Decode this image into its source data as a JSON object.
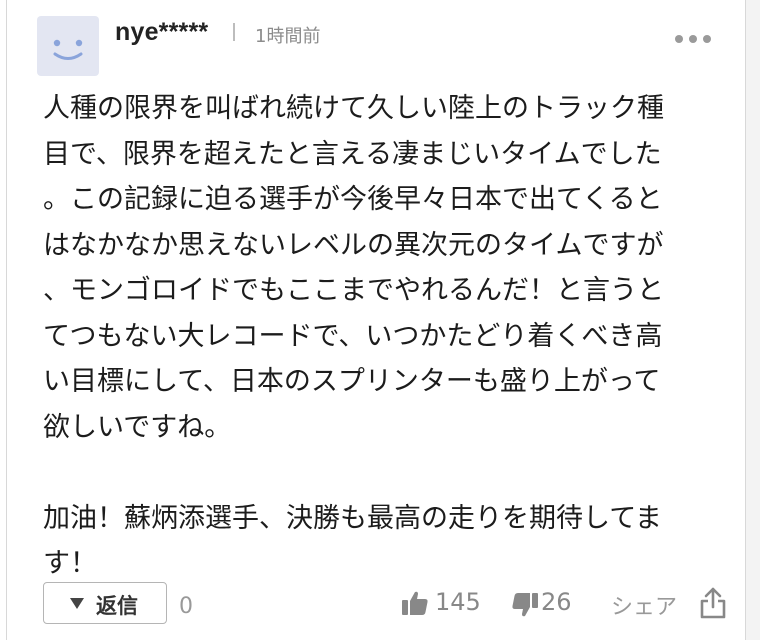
{
  "comment": {
    "user": "nye*****",
    "time": "1時間前",
    "avatar_icon": "smiley-face-icon",
    "more_icon": "more-horizontal-icon",
    "paragraph1": [
      "人種の限界を叫ばれ続けて久しい陸上のトラック種",
      "目で、限界を超えたと言える凄まじいタイムでした",
      "。この記録に迫る選手が今後早々日本で出てくると",
      "はなかなか思えないレベルの異次元のタイムですが",
      "、モンゴロイドでもここまでやれるんだ！と言うと",
      "てつもない大レコードで、いつかたどり着くべき高",
      "い目標にして、日本のスプリンターも盛り上がって",
      "欲しいですね。"
    ],
    "paragraph2": [
      "加油！蘇炳添選手、決勝も最高の走りを期待してま",
      "す！"
    ]
  },
  "footer": {
    "reply_label": "返信",
    "reply_count": "0",
    "like_count": "145",
    "dislike_count": "26",
    "share_label": "シェア",
    "like_icon": "thumbs-up-icon",
    "dislike_icon": "thumbs-down-icon",
    "share_icon": "share-icon"
  },
  "colors": {
    "avatar_bg": "#e3e6f2",
    "avatar_face": "#8aa4db",
    "muted": "#999999"
  }
}
